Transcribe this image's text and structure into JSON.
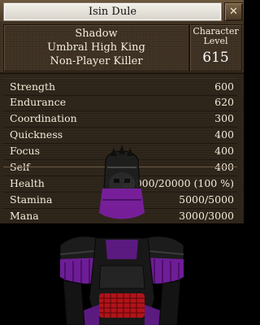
{
  "window": {
    "title": "Isin Dule",
    "close_glyph": "✕"
  },
  "character": {
    "race": "Shadow",
    "title": "Umbral High King",
    "pk_status": "Non-Player Killer",
    "level_label_line1": "Character",
    "level_label_line2": "Level",
    "level": "615"
  },
  "stats": [
    {
      "name": "Strength",
      "value": "600"
    },
    {
      "name": "Endurance",
      "value": "620"
    },
    {
      "name": "Coordination",
      "value": "300"
    },
    {
      "name": "Quickness",
      "value": "400"
    },
    {
      "name": "Focus",
      "value": "400"
    },
    {
      "name": "Self",
      "value": "400"
    },
    {
      "name": "Health",
      "value": "20000/20000 (100 %)"
    },
    {
      "name": "Stamina",
      "value": "5000/5000"
    },
    {
      "name": "Mana",
      "value": "3000/3000"
    }
  ],
  "colors": {
    "panel_bg": "#3e3123",
    "armor": "#1a1a1a",
    "accent_purple": "#7a1fa0",
    "accent_red": "#c0151b"
  },
  "icons": {
    "close": "close-icon"
  }
}
